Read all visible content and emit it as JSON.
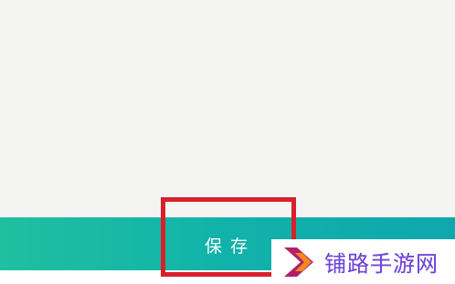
{
  "main": {
    "save_label": "保存"
  },
  "watermark": {
    "text": "铺路手游网",
    "colors": {
      "chevron_outer": "#b21f6a",
      "chevron_inner": "#f08a1c",
      "text": "#6f46d8"
    }
  },
  "annotation": {
    "highlight_color": "#d8202b"
  },
  "theme": {
    "save_bar_start": "#1fbfa0",
    "save_bar_end": "#0ea7ae",
    "background": "#f4f4f3"
  }
}
